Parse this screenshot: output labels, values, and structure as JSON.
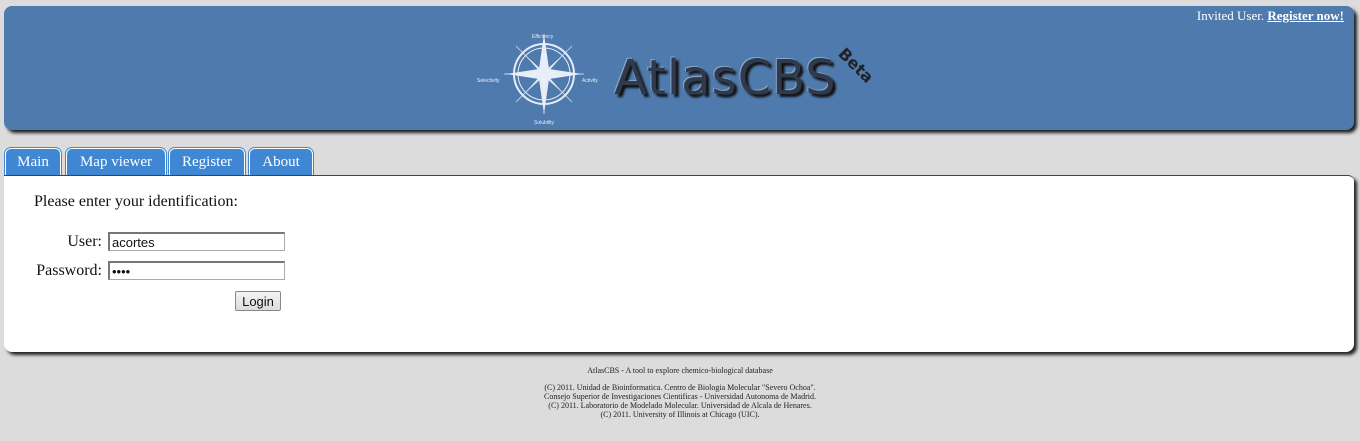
{
  "header": {
    "user_status": "Invited User.",
    "register_link": "Register now!",
    "brand": "AtlasCBS",
    "beta_label": "Beta",
    "compass_labels": {
      "top": "Efficiency",
      "left": "Selectivity",
      "right": "Activity",
      "bottom": "Solubility"
    }
  },
  "tabs": [
    "Main",
    "Map viewer",
    "Register",
    "About"
  ],
  "login": {
    "prompt": "Please enter your identification:",
    "user_label": "User:",
    "user_value": "acortes",
    "password_label": "Password:",
    "password_value": "••••",
    "button_label": "Login"
  },
  "footer": {
    "tagline": "AtlasCBS - A tool to explore chemico-biological database",
    "lines": [
      "(C) 2011. Unidad de Bioinformatica. Centro de Biologia Molecular \"Severo Ochoa\".",
      "Consejo Superior de Investigaciones Cientificas - Universidad Autonoma de Madrid.",
      "(C) 2011. Laboratorio de Modelado Molecular. Universidad de Alcala de Henares.",
      "(C) 2011. University of Illinois at Chicago (UIC)."
    ]
  },
  "colors": {
    "header_bg": "#4f7aad",
    "tab_bg": "#3f87d2",
    "page_bg": "#dcdcdc"
  }
}
